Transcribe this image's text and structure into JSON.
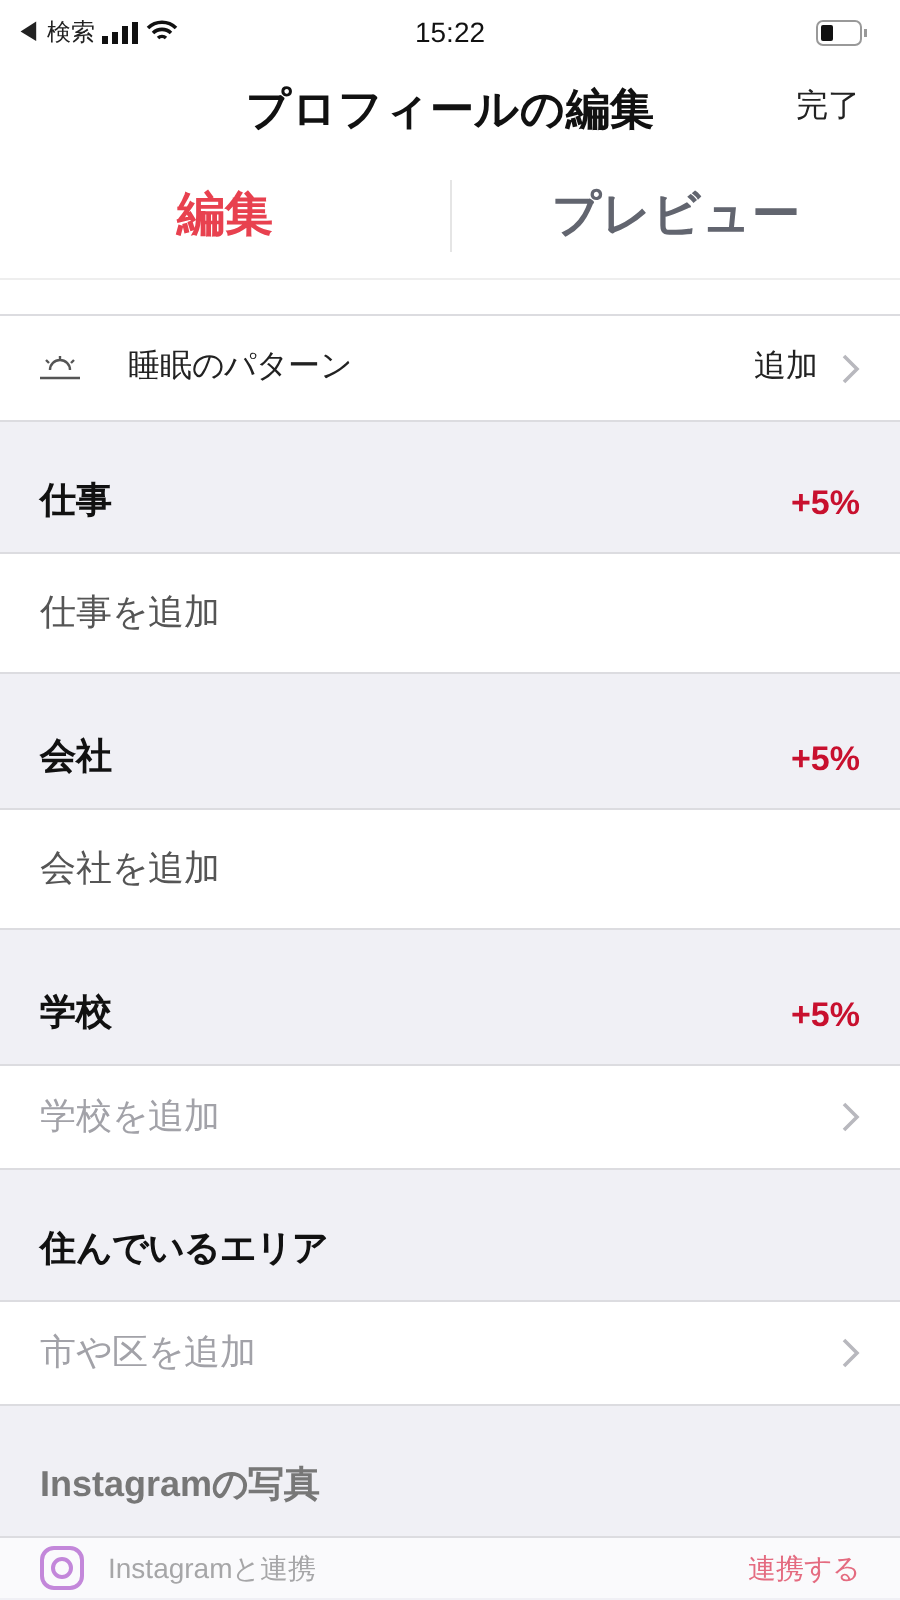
{
  "status_bar": {
    "back": "◀ 検索",
    "time": "15:22"
  },
  "nav": {
    "title": "プロフィールの編集",
    "done": "完了"
  },
  "tabs": [
    {
      "label": "編集",
      "selected": true
    },
    {
      "label": "プレビュー",
      "selected": false
    }
  ],
  "sleep": {
    "label": "睡眠のパターン",
    "action": "追加"
  },
  "sections": [
    {
      "title": "仕事",
      "badge": "+5%",
      "disabled": false,
      "row": {
        "kind": "field",
        "text": "仕事を追加"
      }
    },
    {
      "title": "会社",
      "badge": "+5%",
      "disabled": false,
      "row": {
        "kind": "field",
        "text": "会社を追加"
      }
    },
    {
      "title": "学校",
      "badge": "+5%",
      "disabled": false,
      "row": {
        "kind": "link",
        "text": "学校を追加"
      }
    },
    {
      "title": "住んでいるエリア",
      "disabled": false,
      "row": {
        "kind": "link",
        "text": "市や区を追加"
      }
    },
    {
      "title": "Instagramの写真",
      "disabled": true,
      "row": {
        "kind": "connect",
        "text": "Instagramと連携",
        "action": "連携する"
      }
    }
  ]
}
